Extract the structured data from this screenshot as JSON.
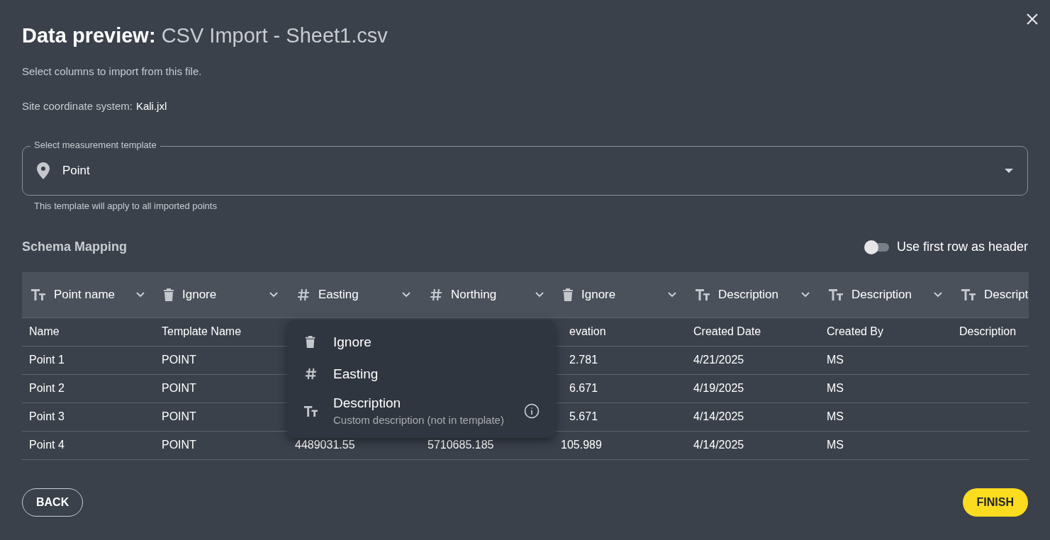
{
  "dialog": {
    "title_bold": "Data preview:",
    "title_rest": "CSV Import - Sheet1.csv",
    "subtitle": "Select columns to import from this file.",
    "coordinate_label": "Site coordinate system:",
    "coordinate_value": "Kali.jxl"
  },
  "template_select": {
    "label": "Select measurement template",
    "value": "Point",
    "helper": "This template will apply to all imported points"
  },
  "schema": {
    "title": "Schema Mapping",
    "toggle": {
      "label": "Use first row as header",
      "on": false
    }
  },
  "table": {
    "mappings": [
      {
        "kind": "text",
        "label": "Point name",
        "caret": true
      },
      {
        "kind": "ignore",
        "label": "Ignore",
        "caret": true
      },
      {
        "kind": "number",
        "label": "Easting",
        "caret": true
      },
      {
        "kind": "number",
        "label": "Northing",
        "caret": true
      },
      {
        "kind": "ignore",
        "label": "Ignore",
        "caret": true
      },
      {
        "kind": "text",
        "label": "Description",
        "caret": true
      },
      {
        "kind": "text",
        "label": "Description",
        "caret": true
      },
      {
        "kind": "text",
        "label": "Descript",
        "caret": false
      }
    ],
    "rows": [
      [
        "Name",
        "Template Name",
        "",
        "",
        "evation",
        "Created Date",
        "Created By",
        "Description"
      ],
      [
        "Point 1",
        "POINT",
        "",
        "",
        "2.781",
        "4/21/2025",
        "MS",
        ""
      ],
      [
        "Point 2",
        "POINT",
        "",
        "",
        "6.671",
        "4/19/2025",
        "MS",
        ""
      ],
      [
        "Point 3",
        "POINT",
        "",
        "",
        "5.671",
        "4/14/2025",
        "MS",
        ""
      ],
      [
        "Point 4",
        "POINT",
        "4489031.55",
        "5710685.185",
        "105.989",
        "4/14/2025",
        "MS",
        ""
      ]
    ]
  },
  "menu": {
    "items": [
      {
        "kind": "ignore",
        "label": "Ignore"
      },
      {
        "kind": "number",
        "label": "Easting"
      },
      {
        "kind": "text",
        "label": "Description",
        "detail": "Custom description (not in template)",
        "info": true
      }
    ]
  },
  "buttons": {
    "back": "BACK",
    "finish": "FINISH"
  }
}
